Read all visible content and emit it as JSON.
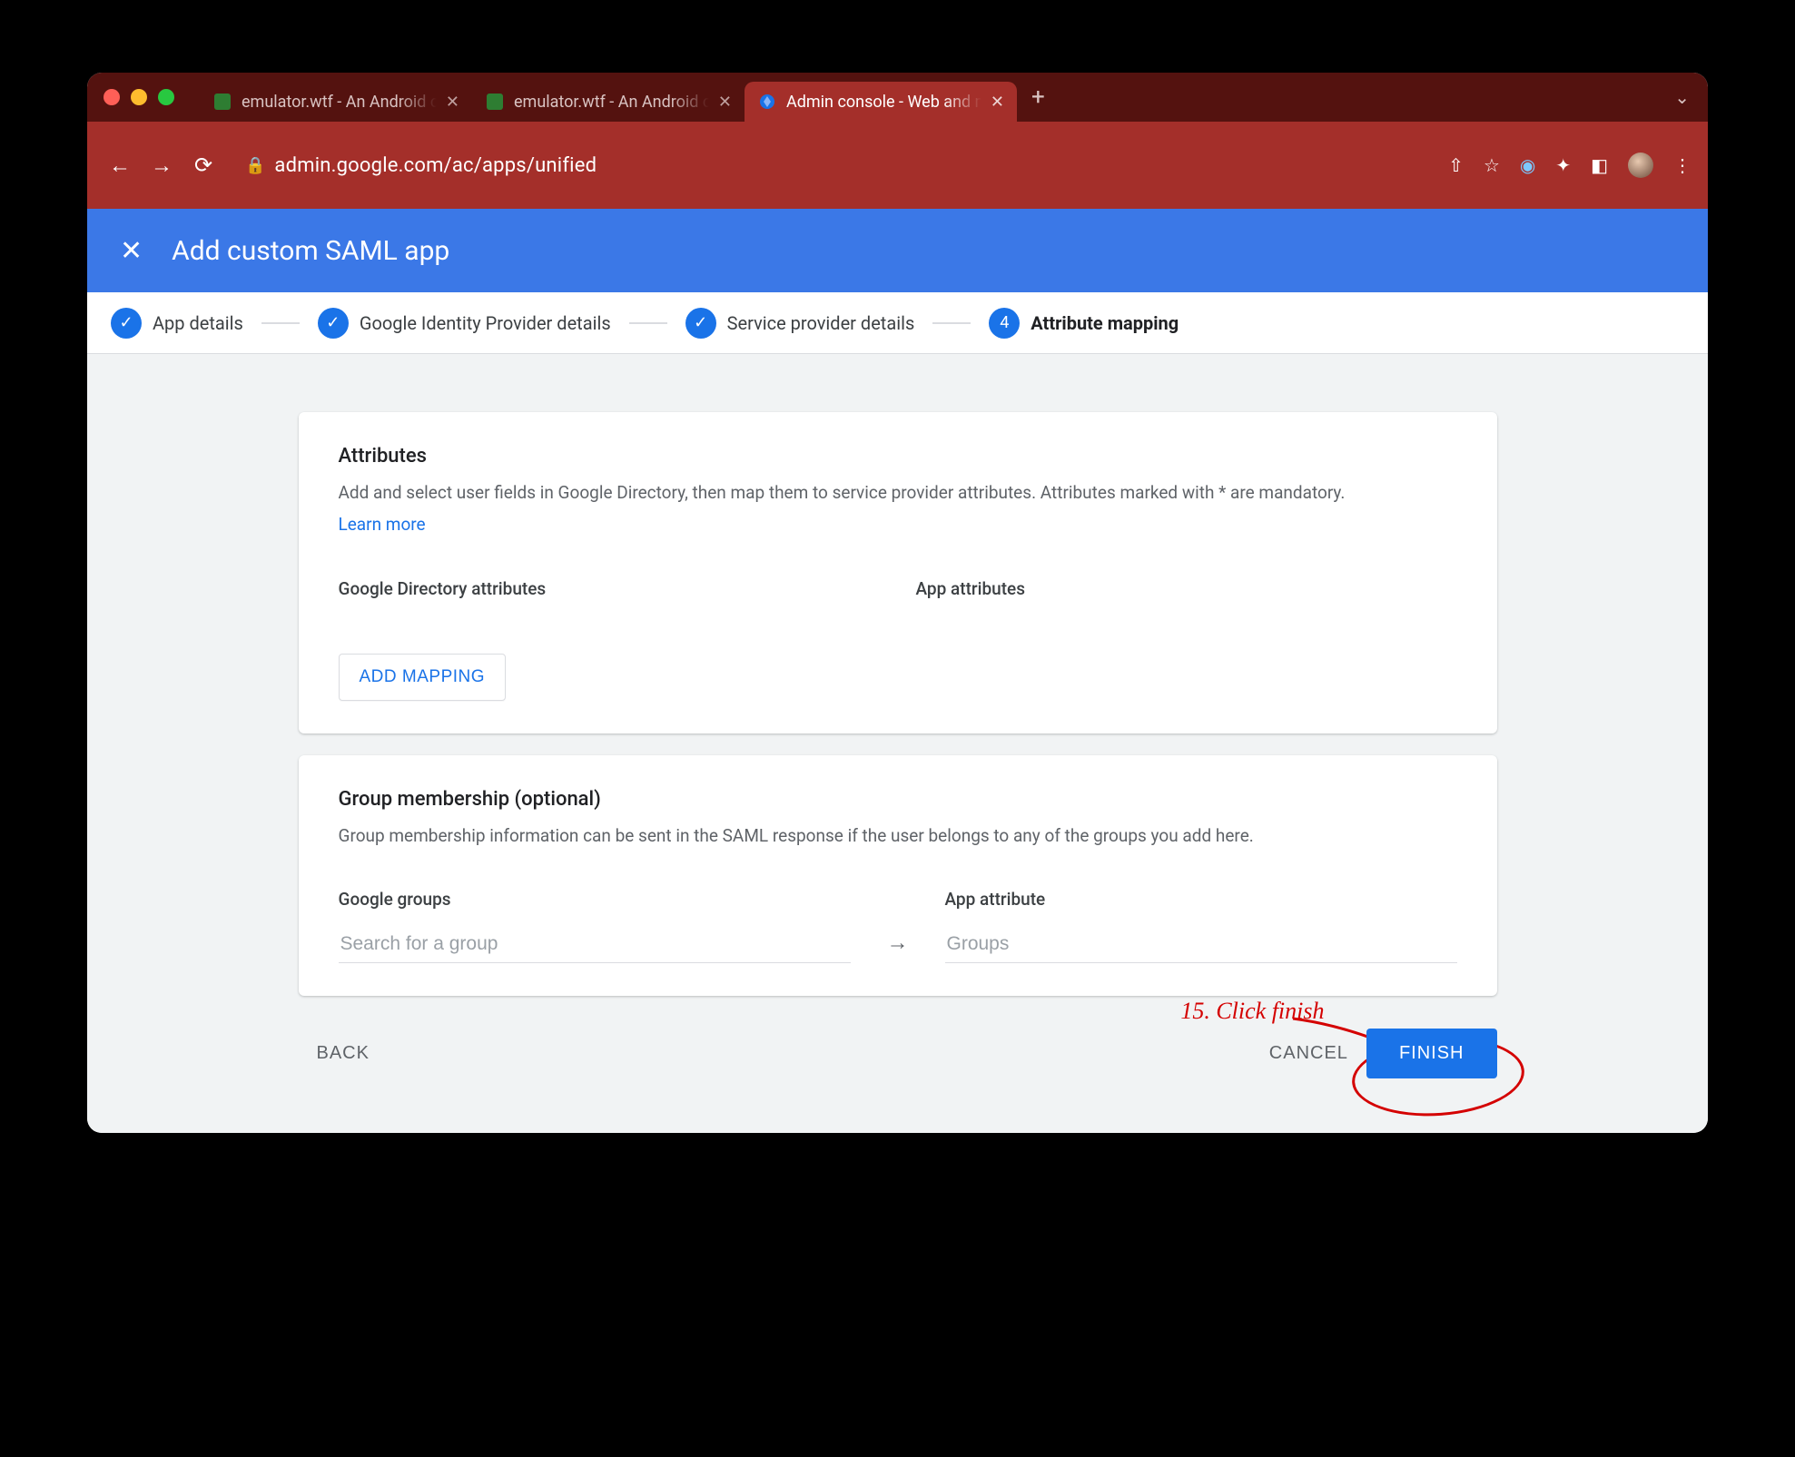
{
  "browser": {
    "tabs": [
      {
        "title": "emulator.wtf - An Android cloud",
        "active": false,
        "favicon": "green-square"
      },
      {
        "title": "emulator.wtf - An Android cloud",
        "active": false,
        "favicon": "green-square"
      },
      {
        "title": "Admin console - Web and mobile",
        "active": true,
        "favicon": "google-admin"
      }
    ],
    "url": "admin.google.com/ac/apps/unified"
  },
  "header": {
    "title": "Add custom SAML app"
  },
  "stepper": {
    "steps": [
      {
        "label": "App details",
        "state": "done"
      },
      {
        "label": "Google Identity Provider details",
        "state": "done"
      },
      {
        "label": "Service provider details",
        "state": "done"
      },
      {
        "label": "Attribute mapping",
        "state": "current",
        "number": "4"
      }
    ]
  },
  "attributes": {
    "heading": "Attributes",
    "description": "Add and select user fields in Google Directory, then map them to service provider attributes. Attributes marked with * are mandatory.",
    "learn_more": "Learn more",
    "col_left": "Google Directory attributes",
    "col_right": "App attributes",
    "add_button": "ADD MAPPING"
  },
  "groups": {
    "heading": "Group membership (optional)",
    "description": "Group membership information can be sent in the SAML response if the user belongs to any of the groups you add here.",
    "left_label": "Google groups",
    "left_placeholder": "Search for a group",
    "right_label": "App attribute",
    "right_placeholder": "Groups"
  },
  "footer": {
    "back": "BACK",
    "cancel": "CANCEL",
    "finish": "FINISH"
  },
  "annotation": {
    "text": "15. Click finish"
  }
}
